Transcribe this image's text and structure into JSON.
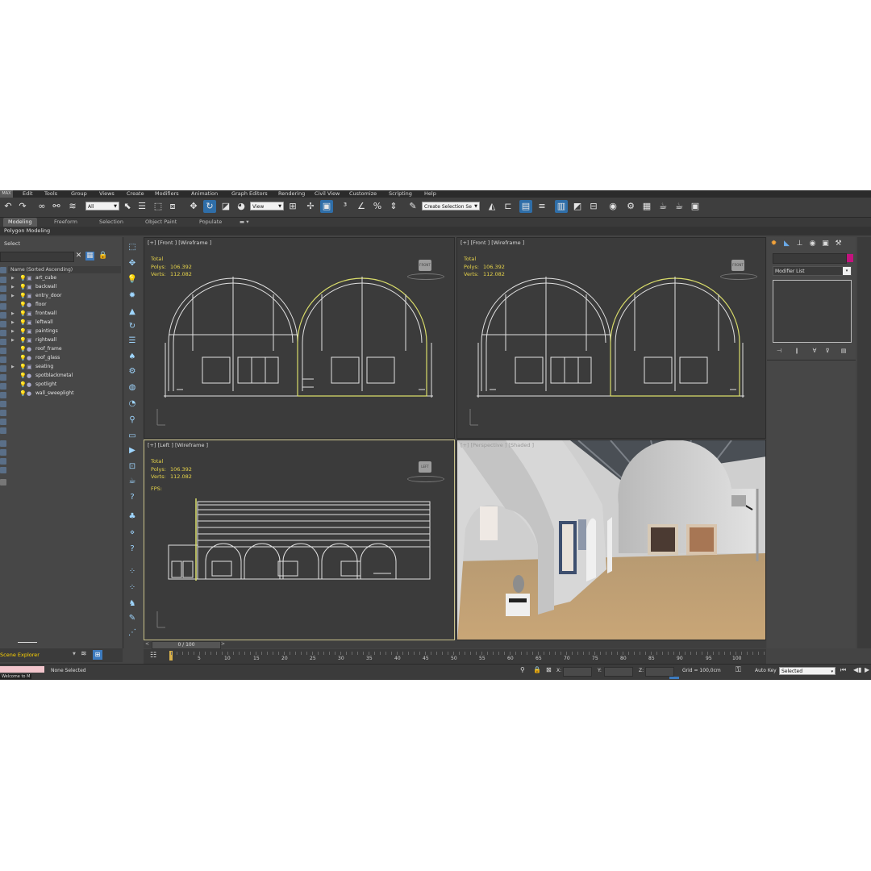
{
  "app": {
    "logo": "MAX"
  },
  "menu": [
    "Edit",
    "Tools",
    "Group",
    "Views",
    "Create",
    "Modifiers",
    "Animation",
    "Graph Editors",
    "Rendering",
    "Civil View",
    "Customize",
    "Scripting",
    "Help"
  ],
  "toolbar": {
    "filter_value": "All",
    "refcoord_value": "View",
    "selection_set_placeholder": "Create Selection Se"
  },
  "ribbon": {
    "tabs": [
      "Modeling",
      "Freeform",
      "Selection",
      "Object Paint",
      "Populate"
    ],
    "active": "Modeling",
    "subpanel": "Polygon Modeling"
  },
  "scene_explorer": {
    "title": "Select",
    "column_header": "Name (Sorted Ascending)",
    "items": [
      "art_cube",
      "backwall",
      "entry_door",
      "floor",
      "frontwall",
      "leftwall",
      "paintings",
      "rightwall",
      "roof_frame",
      "roof_glass",
      "seating",
      "spotblackmetal",
      "spotlight",
      "wall_sweeplight"
    ],
    "footer_label": "Scene Explorer"
  },
  "viewports": {
    "top_left": {
      "label": "[+] [Front ] [Wireframe ]",
      "stats_title": "Total",
      "polys_label": "Polys:",
      "polys": "106.392",
      "verts_label": "Verts:",
      "verts": "112.082",
      "cube": "FRONT"
    },
    "top_right": {
      "label": "[+] [Front ] [Wireframe ]",
      "stats_title": "Total",
      "polys_label": "Polys:",
      "polys": "106.392",
      "verts_label": "Verts:",
      "verts": "112.082",
      "cube": "FRONT"
    },
    "bottom_left": {
      "label": "[+] [Left ] [Wireframe ]",
      "stats_title": "Total",
      "polys_label": "Polys:",
      "polys": "106.392",
      "verts_label": "Verts:",
      "verts": "112.082",
      "fps_label": "FPS:",
      "cube": "LEFT"
    },
    "bottom_right": {
      "label": "[+] [Perspective ] [Shaded ]"
    }
  },
  "command_panel": {
    "modifier_list": "Modifier List",
    "color": "#c3137e"
  },
  "timeline": {
    "frame_display": "0 / 100",
    "ticks": [
      "5",
      "10",
      "15",
      "20",
      "25",
      "30",
      "35",
      "40",
      "45",
      "50",
      "55",
      "60",
      "65",
      "70",
      "75",
      "80",
      "85",
      "90",
      "95",
      "100"
    ]
  },
  "status": {
    "selection_text": "None Selected",
    "x_label": "X:",
    "y_label": "Y:",
    "z_label": "Z:",
    "grid": "Grid = 100,0cm",
    "autokey": "Auto Key",
    "selected_value": "Selected",
    "listener": "Welcome to M"
  }
}
